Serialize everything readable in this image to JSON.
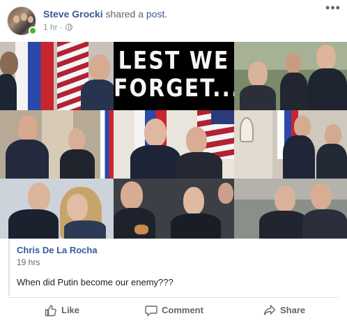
{
  "post": {
    "author": "Steve Grocki",
    "action_text": "shared a",
    "link_text": "post.",
    "timestamp": "1 hr",
    "separator": "·",
    "more_icon": "more-options-icon",
    "privacy_icon": "globe-icon"
  },
  "collage": {
    "banner_line1": "LEST WE",
    "banner_line2": "FORGET...",
    "tiles": 9
  },
  "shared_post": {
    "author": "Chris De La Rocha",
    "timestamp": "19 hrs",
    "text": "When did Putin become our enemy???"
  },
  "actions": {
    "like_label": "Like",
    "comment_label": "Comment",
    "share_label": "Share"
  },
  "colors": {
    "link": "#385898",
    "muted": "#606770",
    "online": "#42b72a"
  }
}
